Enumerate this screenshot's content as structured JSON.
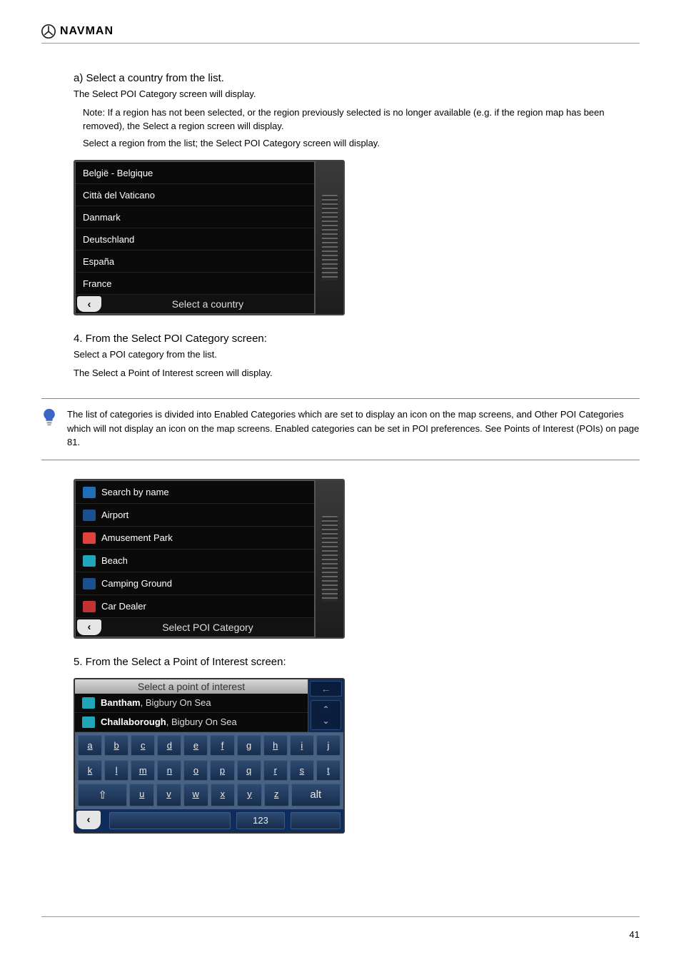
{
  "header": {
    "brand": "NAVMAN"
  },
  "sectionA": {
    "heading": "a)    Select a country from the list.",
    "line": "The Select POI Category screen will display."
  },
  "noteA": {
    "p1": "Note: If a region has not been selected, or the region previously selected is no longer available (e.g. if the region map has been removed), the Select a region screen will display.",
    "p2": "Select a region from the list; the Select POI Category screen will display."
  },
  "screen1": {
    "footerTitle": "Select a country",
    "items": [
      "België - Belgique",
      "Città del Vaticano",
      "Danmark",
      "Deutschland",
      "España",
      "France"
    ]
  },
  "step4": {
    "heading": "4.    From the Select POI Category screen:",
    "line": "Select a POI category from the list.",
    "result": "The Select a Point of Interest screen will display."
  },
  "tip": {
    "text": "The list of categories is divided into Enabled Categories which are set to display an icon on the map screens, and Other POI Categories which will not display an icon on the map screens. Enabled categories can be set in POI preferences. See Points of Interest (POIs) on page 81."
  },
  "screen2": {
    "footerTitle": "Select POI Category",
    "items": [
      "Search by name",
      "Airport",
      "Amusement Park",
      "Beach",
      "Camping Ground",
      "Car Dealer"
    ]
  },
  "step5": {
    "heading": "5.    From the Select a Point of Interest screen:"
  },
  "screen3": {
    "title": "Select a point of interest",
    "backWord": "Back",
    "results": [
      {
        "bold": "Bantham",
        "rest": ", Bigbury On Sea"
      },
      {
        "bold": "Challaborough",
        "rest": ", Bigbury On Sea"
      }
    ],
    "row1": [
      "a",
      "b",
      "c",
      "d",
      "e",
      "f",
      "g",
      "h",
      "i",
      "j"
    ],
    "row2": [
      "k",
      "l",
      "m",
      "n",
      "o",
      "p",
      "q",
      "r",
      "s",
      "t"
    ],
    "row3_shift": "⇧",
    "row3_keys": [
      "u",
      "v",
      "w",
      "x",
      "y",
      "z"
    ],
    "row3_alt": "alt",
    "numKey": "123"
  },
  "page_number": "41"
}
